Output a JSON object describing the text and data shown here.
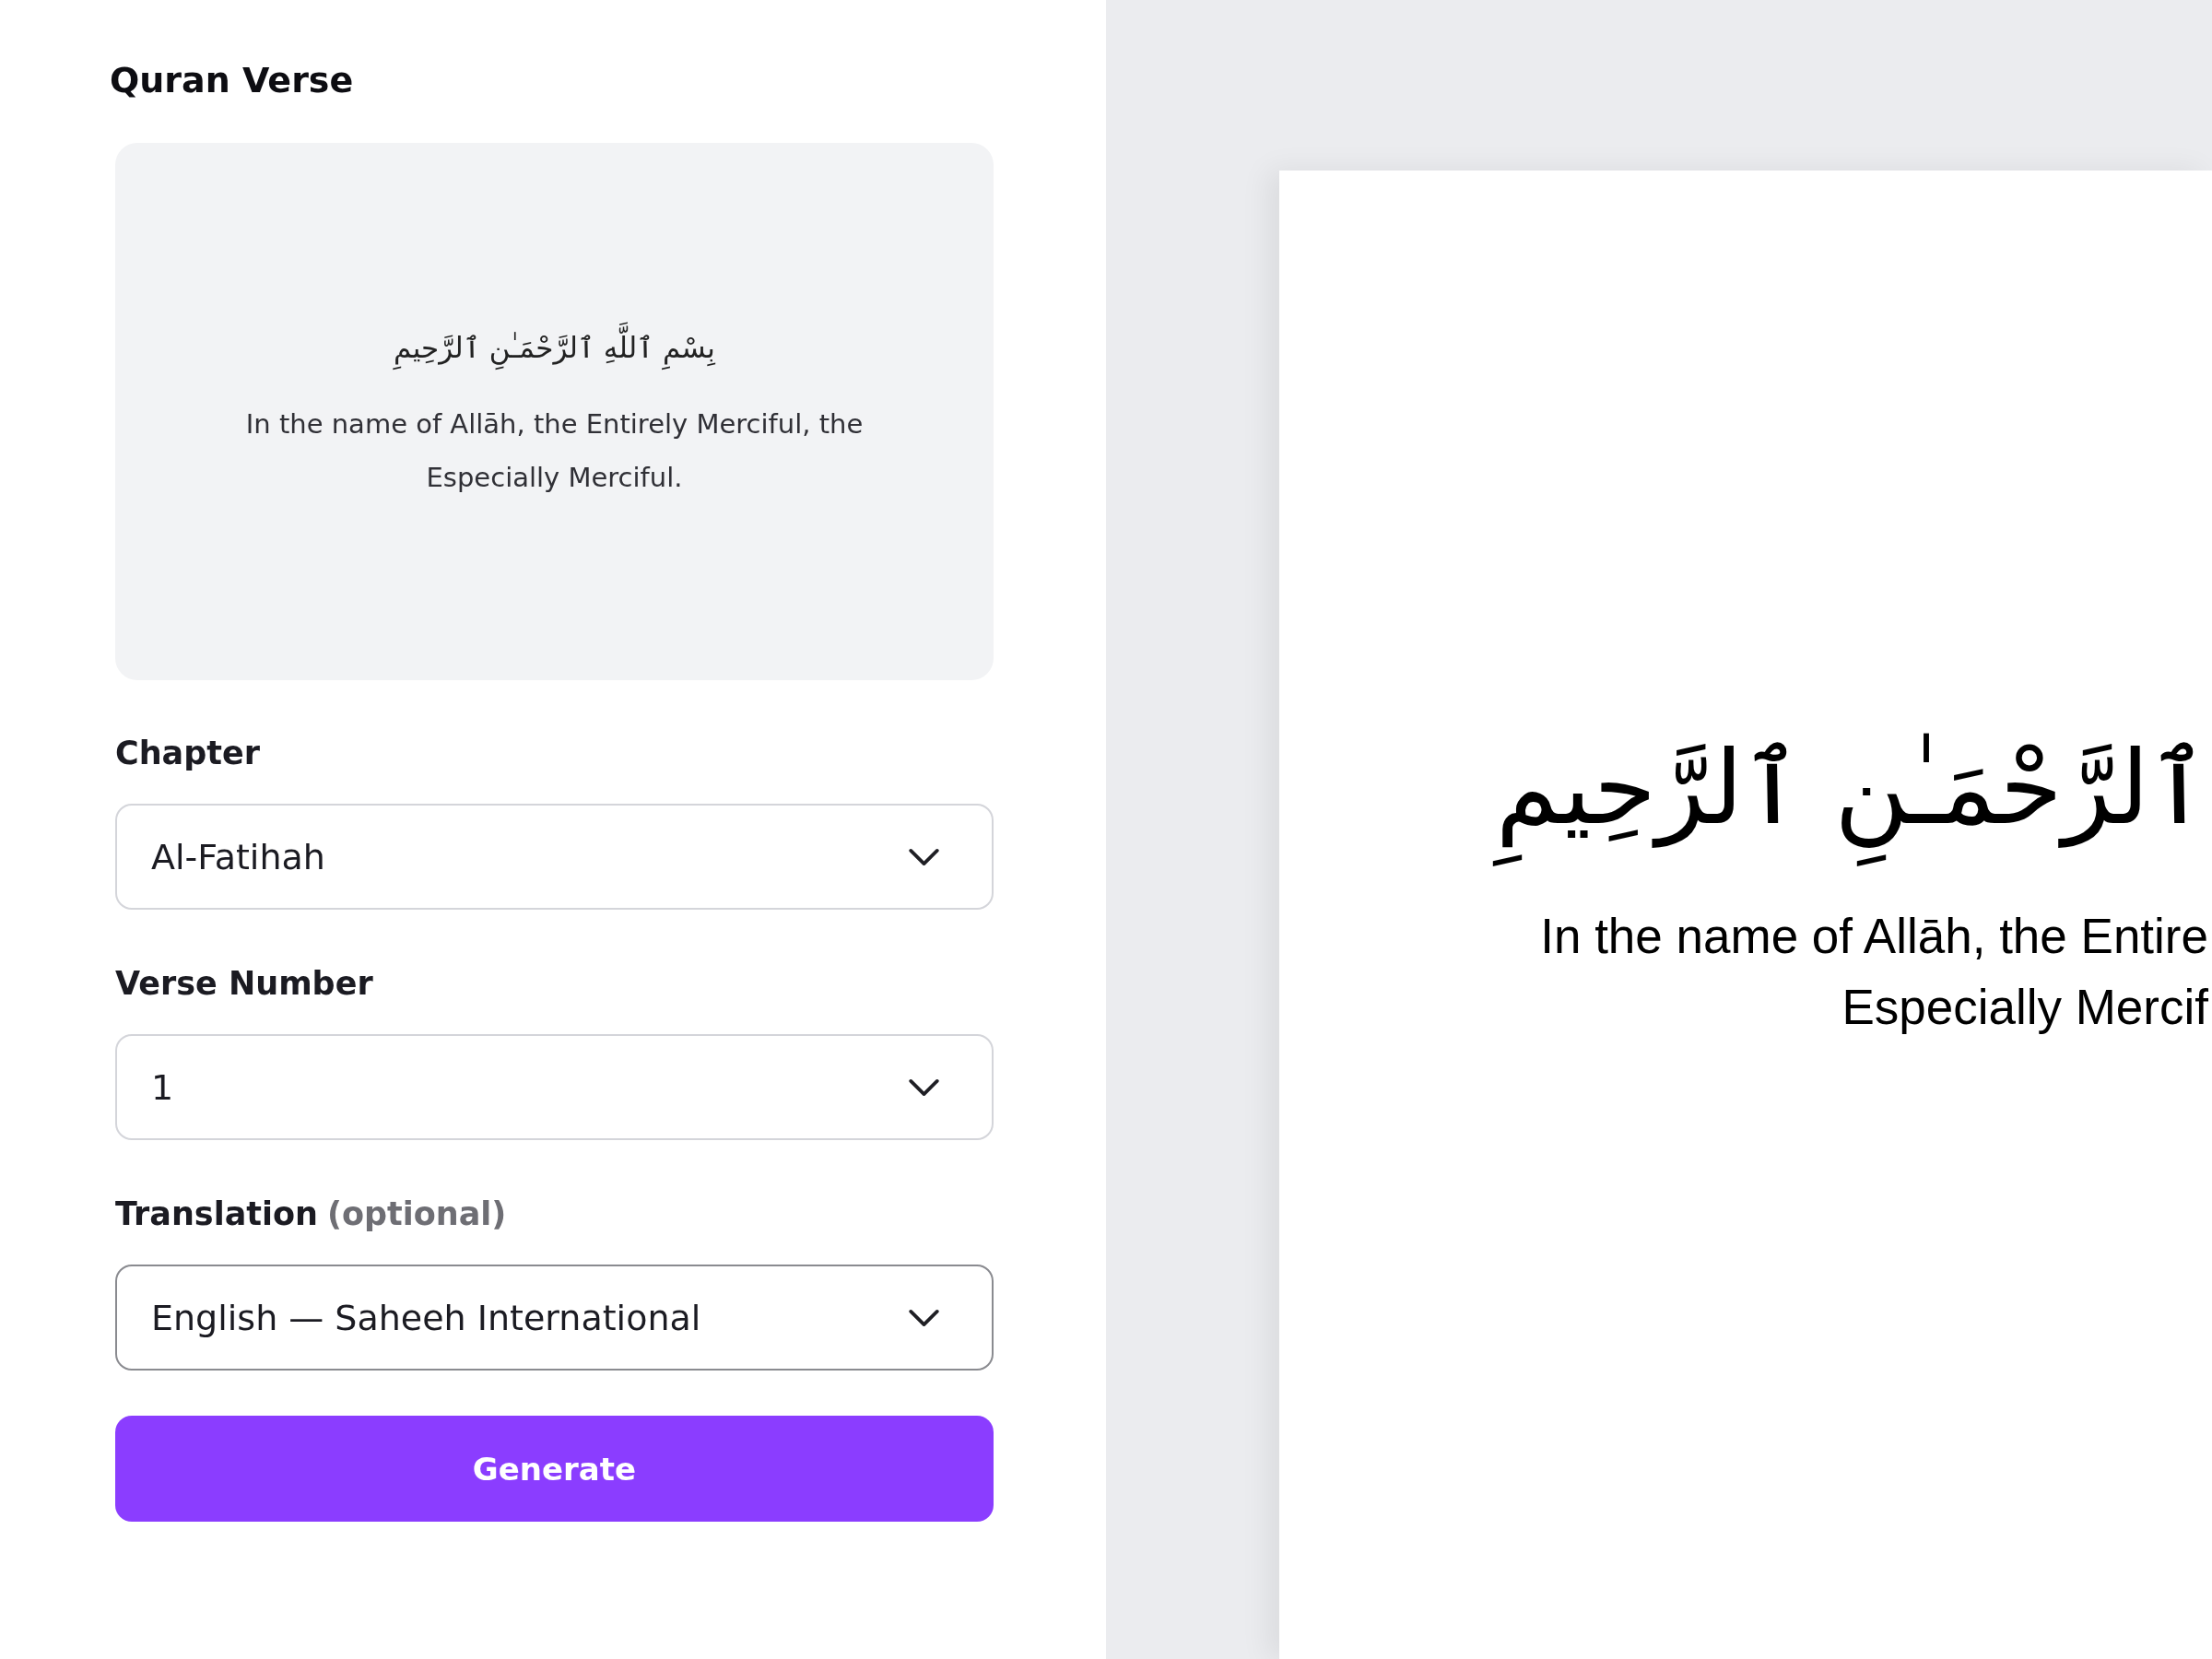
{
  "panel": {
    "title": "Quran Verse"
  },
  "preview": {
    "arabic": "بِسْمِ ٱللَّهِ ٱلرَّحْمَـٰنِ ٱلرَّحِيمِ",
    "translation": "In the name of Allāh, the Entirely Merciful, the Especially Merciful."
  },
  "fields": [
    {
      "label": "Chapter",
      "value": "Al-Fatihah",
      "focused": false
    },
    {
      "label": "Verse Number",
      "value": "1",
      "focused": false
    },
    {
      "label": "Translation",
      "hint": "(optional)",
      "value": "English — Saheeh International",
      "focused": true
    }
  ],
  "generate_button": {
    "label": "Generate"
  },
  "canvas": {
    "arabic": "ٱلرَّحْمَـٰنِ ٱلرَّحِيمِ",
    "translation_lines": [
      "In the name of Allāh, the Entire",
      "Especially Mercif"
    ]
  }
}
